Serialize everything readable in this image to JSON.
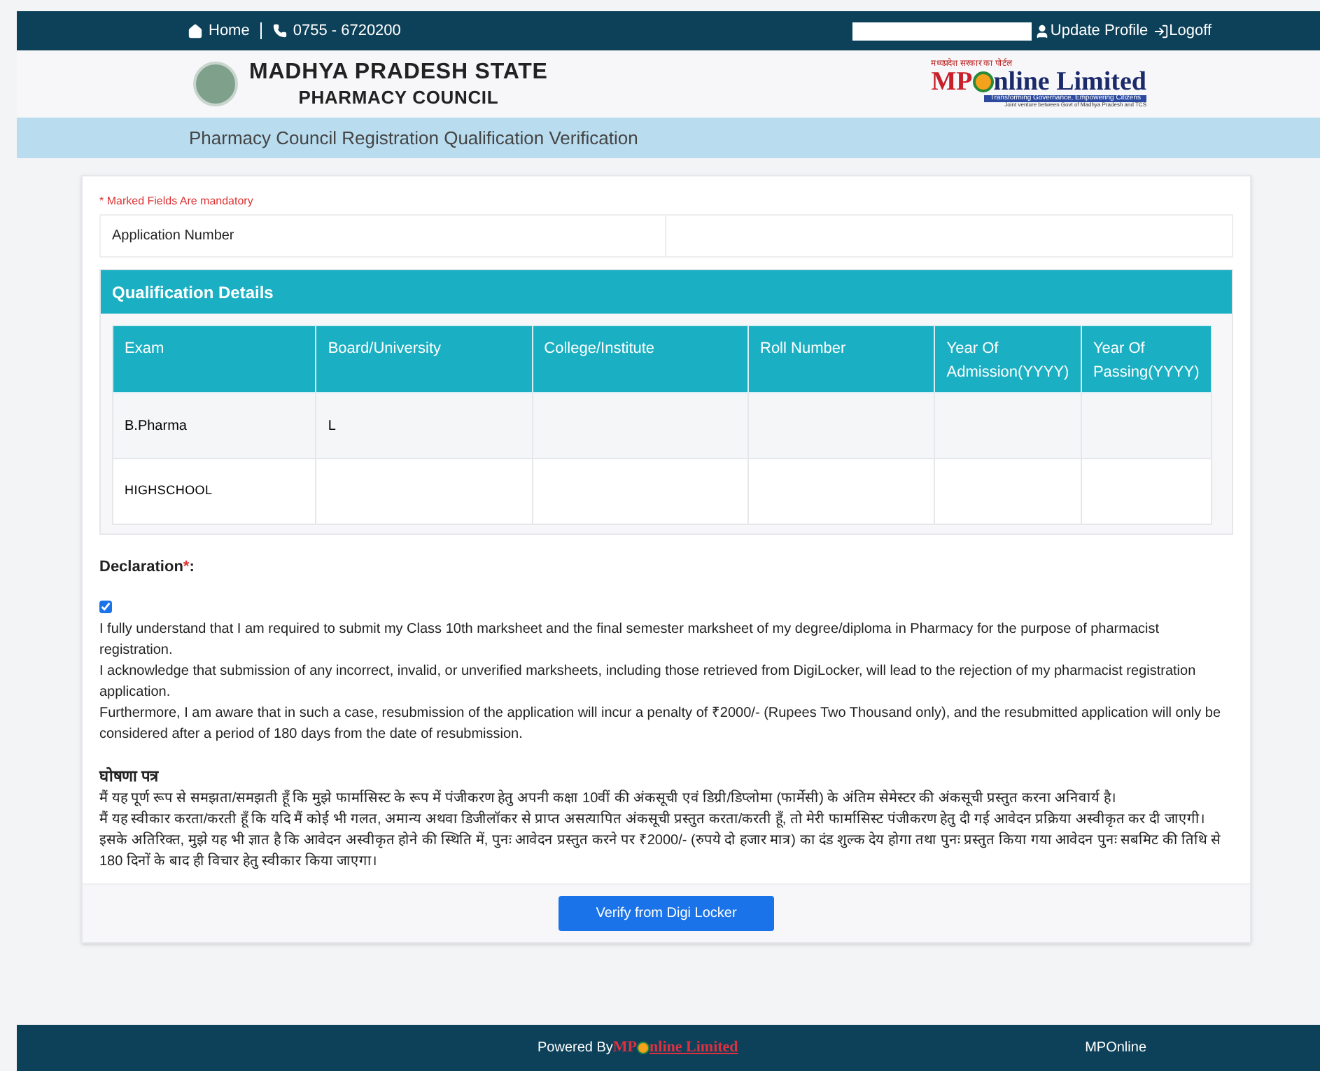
{
  "top_bar": {
    "home": "Home",
    "phone": "0755 - 6720200",
    "update_profile": "Update Profile",
    "logoff": "Logoff"
  },
  "header": {
    "council_line1": "MADHYA PRADESH STATE",
    "council_line2": "PHARMACY COUNCIL",
    "partner_top": "मध्यप्रदेश सरकार का पोर्टल",
    "partner_mp": "MP",
    "partner_rest": "nline Limited",
    "partner_tagline": "Transforming Governance, Empowering Citizens",
    "partner_note": "Joint venture between Govt of Madhya Pradesh and TCS"
  },
  "page_title": "Pharmacy Council Registration Qualification Verification",
  "mandatory_note": "* Marked Fields Are mandatory",
  "application_number": {
    "label": "Application Number"
  },
  "qualification": {
    "title": "Qualification Details",
    "columns": [
      "Exam",
      "Board/University",
      "College/Institute",
      "Roll Number",
      "Year Of Admission(YYYY)",
      "Year Of Passing(YYYY)"
    ],
    "rows": [
      {
        "cells": [
          "B.Pharma",
          "L",
          "",
          "",
          "",
          ""
        ]
      },
      {
        "cells": [
          "HIGHSCHOOL",
          "",
          "",
          "",
          "",
          ""
        ]
      }
    ]
  },
  "declaration": {
    "label": "Declaration",
    "required_mark": "*",
    "colon": ":",
    "checked": true,
    "paragraphs": [
      "I fully understand that I am required to submit my Class 10th marksheet and the final semester marksheet of my degree/diploma in Pharmacy for the purpose of pharmacist registration.",
      "I acknowledge that submission of any incorrect, invalid, or unverified marksheets, including those retrieved from DigiLocker, will lead to the rejection of my pharmacist registration application.",
      "Furthermore, I am aware that in such a case, resubmission of the application will incur a penalty of ₹2000/- (Rupees Two Thousand only), and the resubmitted application will only be considered after a period of 180 days from the date of resubmission."
    ],
    "hindi_title": "घोषणा पत्र",
    "hindi_paragraphs": [
      "मैं यह पूर्ण रूप से समझता/समझती हूँ कि मुझे फार्मासिस्ट के रूप में पंजीकरण हेतु अपनी कक्षा 10वीं की अंकसूची एवं डिग्री/डिप्लोमा (फार्मेसी) के अंतिम सेमेस्टर की अंकसूची प्रस्तुत करना अनिवार्य है।",
      "मैं यह स्वीकार करता/करती हूँ कि यदि मैं कोई भी गलत, अमान्य अथवा डिजीलॉकर से प्राप्त असत्यापित अंकसूची प्रस्तुत करता/करती हूँ, तो मेरी फार्मासिस्ट पंजीकरण हेतु दी गई आवेदन प्रक्रिया अस्वीकृत कर दी जाएगी।",
      "इसके अतिरिक्त, मुझे यह भी ज्ञात है कि आवेदन अस्वीकृत होने की स्थिति में, पुनः आवेदन प्रस्तुत करने पर ₹2000/- (रुपये दो हजार मात्र) का दंड शुल्क देय होगा तथा पुनः प्रस्तुत किया गया आवेदन पुनः सबमिट की तिथि से 180 दिनों के बाद ही विचार हेतु स्वीकार किया जाएगा।"
    ]
  },
  "verify_button": "Verify from Digi Locker",
  "footer": {
    "powered_by": "Powered By",
    "logo_mp": "MP",
    "logo_rest": "nline Limited",
    "right": "MPOnline"
  }
}
